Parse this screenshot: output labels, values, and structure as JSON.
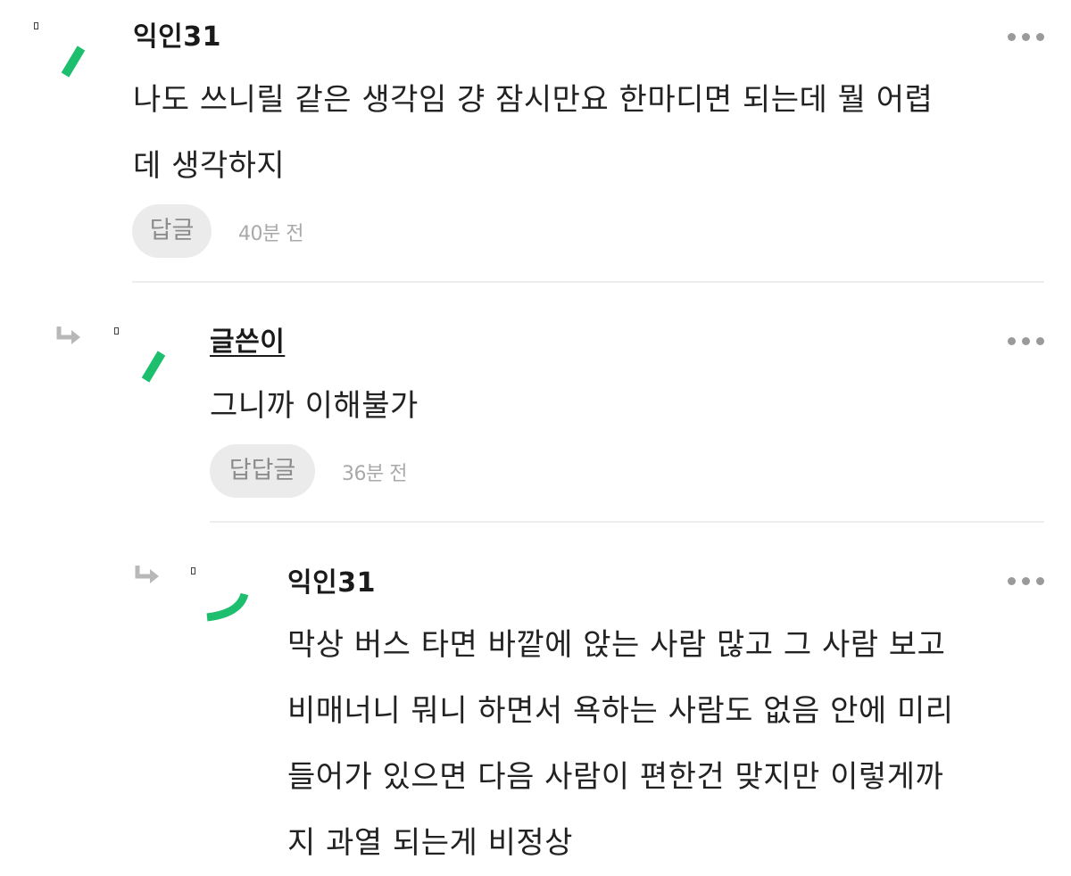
{
  "comments": [
    {
      "nickname": "익인31",
      "text": "나도 쓰니릴 같은 생각임 걍 잠시만요 한마디면 되는데 뭘 어렵\n데 생각하지",
      "reply_label": "답글",
      "time": "40분 전",
      "avatar_icon": "green-slash-avatar"
    },
    {
      "nickname": "글쓴이",
      "text": "그니까 이해불가",
      "reply_label": "답답글",
      "time": "36분 전",
      "avatar_icon": "green-slash-avatar"
    },
    {
      "nickname": "익인31",
      "text": "막상 버스 타면 바깥에 앉는 사람 많고 그 사람 보고\n비매너니 뭐니 하면서 욕하는 사람도 없음 안에 미리\n들어가 있으면 다음 사람이 편한건 맞지만 이렇게까\n지 과열 되는게 비정상",
      "avatar_icon": "green-arc-avatar"
    }
  ],
  "colors": {
    "accent_green": "#1dbf6f",
    "divider": "#ededed",
    "button_bg": "#ebebeb"
  }
}
